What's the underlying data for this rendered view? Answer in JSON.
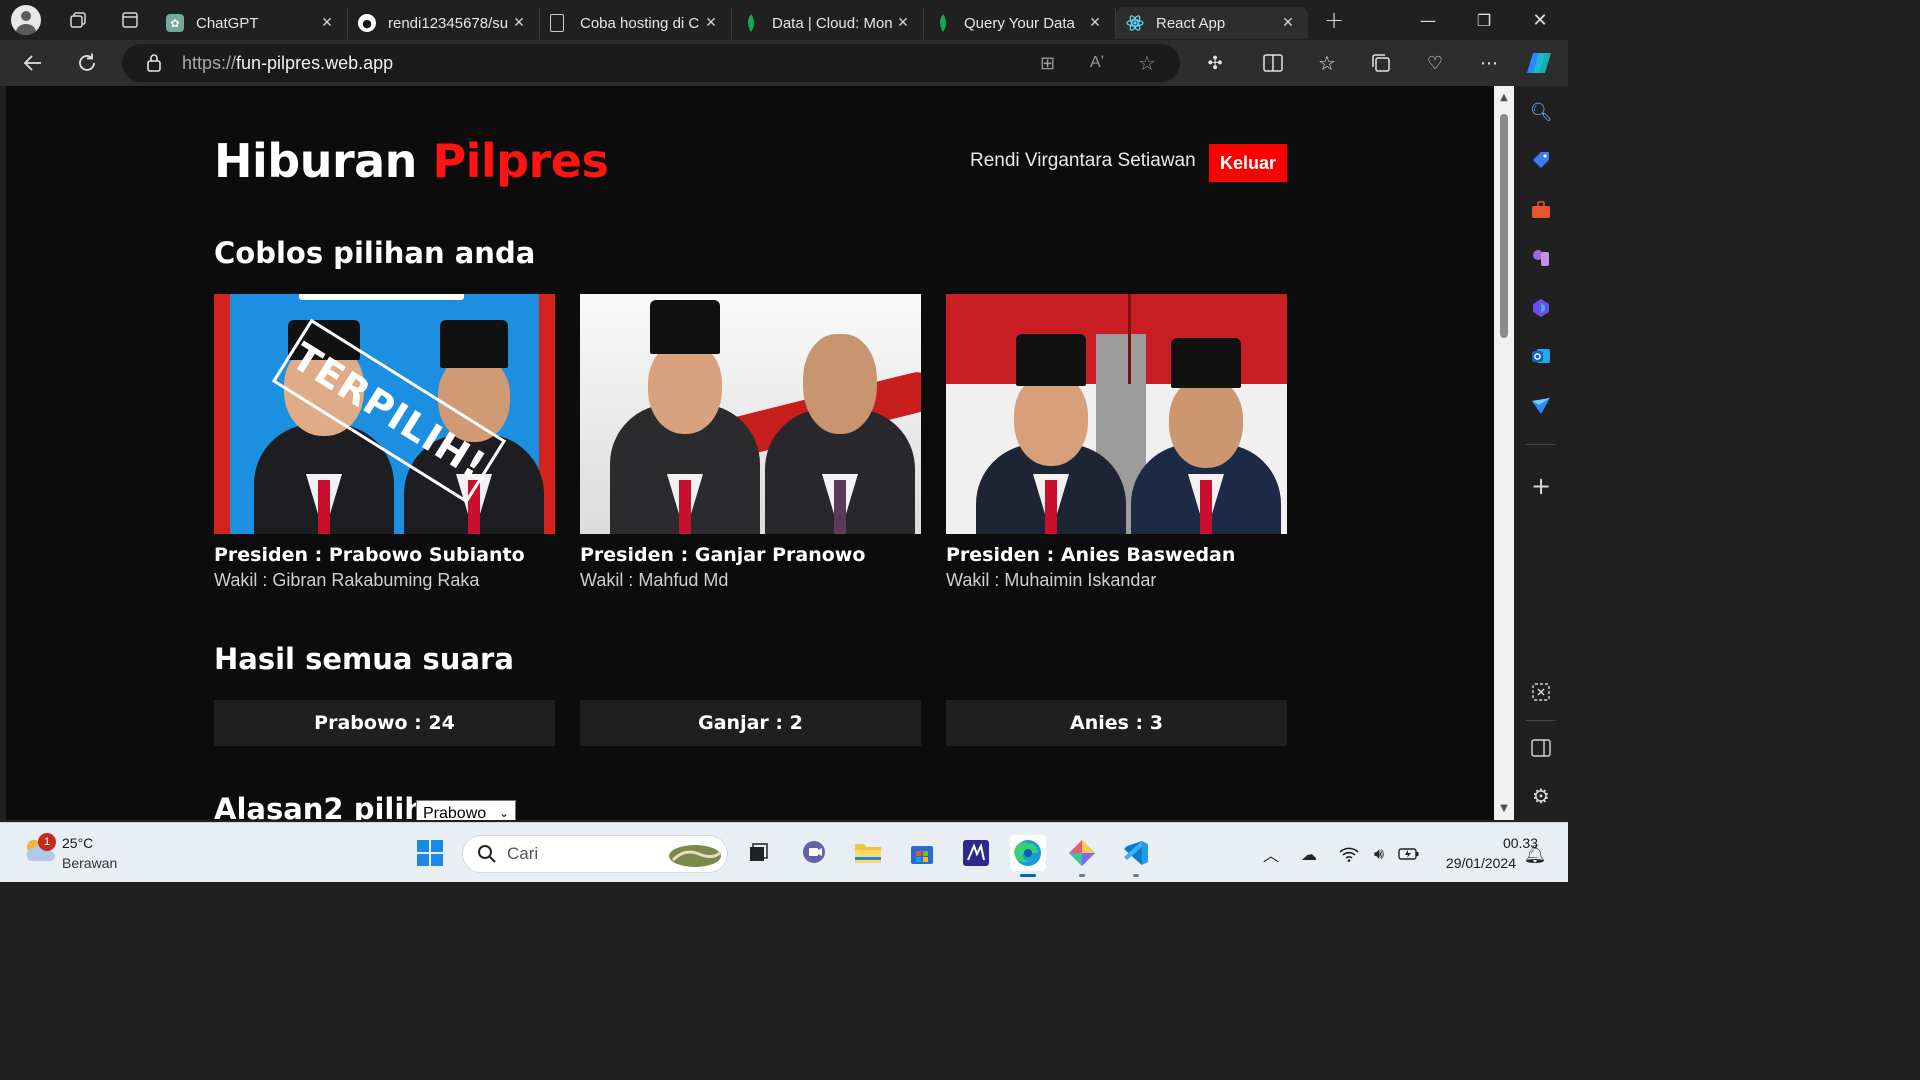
{
  "browser": {
    "tabs": [
      {
        "title": "ChatGPT",
        "icon": "chatgpt-icon",
        "color": "#74aa9c",
        "active": false
      },
      {
        "title": "rendi12345678/su",
        "icon": "github-icon",
        "color": "#ffffff",
        "active": false
      },
      {
        "title": "Coba hosting di C",
        "icon": "document-icon",
        "color": "#cccccc",
        "active": false
      },
      {
        "title": "Data | Cloud: Mon",
        "icon": "mongodb-leaf-icon",
        "color": "#13aa52",
        "active": false
      },
      {
        "title": "Query Your Data",
        "icon": "mongodb-leaf-icon",
        "color": "#13aa52",
        "active": false
      },
      {
        "title": "React App",
        "icon": "react-icon",
        "color": "#61dafb",
        "active": true
      }
    ],
    "url_scheme": "https://",
    "url_host": "fun-pilpres.web.app"
  },
  "app": {
    "title_main": "Hiburan",
    "title_accent": "Pilpres",
    "accent_color": "#ff1313",
    "user_name": "Rendi Virgantara Setiawan",
    "logout_label": "Keluar",
    "vote_section_title": "Coblos pilihan anda",
    "candidates": [
      {
        "president": "Presiden : Prabowo Subianto",
        "vice": "Wakil : Gibran Rakabuming Raka",
        "stamp": "TERPILIH!",
        "bg": "#1d8fe0"
      },
      {
        "president": "Presiden : Ganjar Pranowo",
        "vice": "Wakil : Mahfud Md",
        "stamp": "",
        "bg": "#f2f2f2"
      },
      {
        "president": "Presiden : Anies Baswedan",
        "vice": "Wakil : Muhaimin Iskandar",
        "stamp": "",
        "bg": "#e8e8e8"
      }
    ],
    "results_section_title": "Hasil semua suara",
    "results": [
      {
        "label": "Prabowo : 24"
      },
      {
        "label": "Ganjar : 2"
      },
      {
        "label": "Anies : 3"
      }
    ],
    "reasons_section_title": "Alasan2 pilih",
    "reasons_select_value": "Prabowo"
  },
  "taskbar": {
    "weather_temp": "25°C",
    "weather_desc": "Berawan",
    "weather_badge": "1",
    "search_placeholder": "Cari",
    "clock_time": "00.33",
    "clock_date": "29/01/2024"
  }
}
